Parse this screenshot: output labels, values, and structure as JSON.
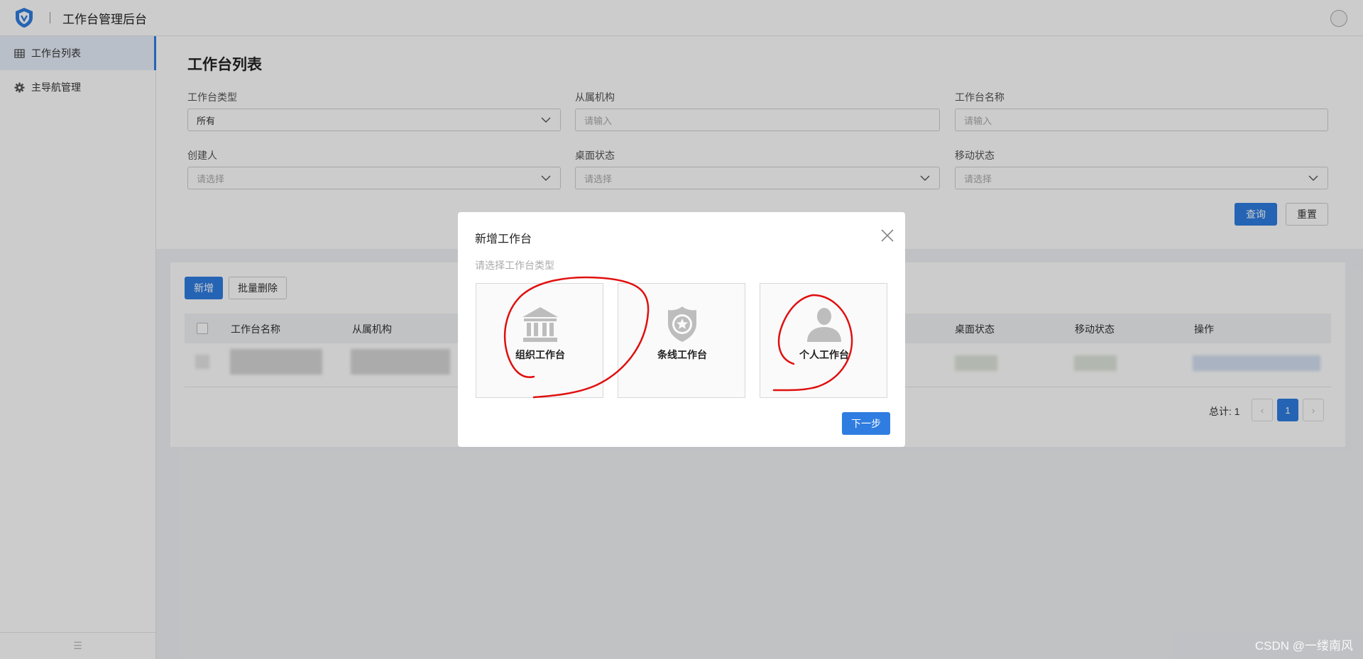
{
  "header": {
    "title": "工作台管理后台"
  },
  "sidebar": {
    "items": [
      {
        "label": "工作台列表",
        "icon": "table-icon",
        "active": true
      },
      {
        "label": "主导航管理",
        "icon": "gear-icon",
        "active": false
      }
    ],
    "footer_icon": "collapse-icon"
  },
  "filter": {
    "page_title": "工作台列表",
    "fields": [
      {
        "label": "工作台类型",
        "value": "所有",
        "type": "select"
      },
      {
        "label": "从属机构",
        "placeholder": "请输入",
        "type": "input"
      },
      {
        "label": "工作台名称",
        "placeholder": "请输入",
        "type": "input"
      },
      {
        "label": "创建人",
        "placeholder": "请选择",
        "type": "select"
      },
      {
        "label": "桌面状态",
        "placeholder": "请选择",
        "type": "select"
      },
      {
        "label": "移动状态",
        "placeholder": "请选择",
        "type": "select"
      }
    ],
    "query_label": "查询",
    "reset_label": "重置"
  },
  "table": {
    "add_label": "新增",
    "batch_delete_label": "批量删除",
    "columns": [
      "工作台名称",
      "从属机构",
      "桌面状态",
      "移动状态",
      "操作"
    ],
    "total_label": "总计: 1",
    "current_page": "1",
    "prev_glyph": "‹",
    "next_glyph": "›"
  },
  "modal": {
    "title": "新增工作台",
    "subtitle": "请选择工作台类型",
    "options": [
      {
        "label": "组织工作台",
        "icon": "bank-icon"
      },
      {
        "label": "条线工作台",
        "icon": "badge-icon"
      },
      {
        "label": "个人工作台",
        "icon": "person-icon"
      }
    ],
    "next_label": "下一步"
  },
  "watermark": "CSDN @一缕南风",
  "colors": {
    "primary": "#2f7de1",
    "annotation": "#e0100f"
  }
}
